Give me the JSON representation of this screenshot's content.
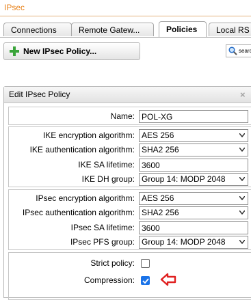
{
  "app": {
    "title": "IPsec"
  },
  "tabs": [
    {
      "label": "Connections"
    },
    {
      "label": "Remote Gatew..."
    },
    {
      "label": "Policies"
    },
    {
      "label": "Local RS"
    }
  ],
  "toolbar": {
    "new_policy_label": "New IPsec Policy...",
    "search_placeholder": "search"
  },
  "dialog": {
    "title": "Edit IPsec Policy",
    "close_glyph": "×",
    "name": {
      "label": "Name:",
      "value": "POL-XG"
    },
    "ike_encryption": {
      "label": "IKE encryption algorithm:",
      "value": "AES 256"
    },
    "ike_authentication": {
      "label": "IKE authentication algorithm:",
      "value": "SHA2 256"
    },
    "ike_sa_lifetime": {
      "label": "IKE SA lifetime:",
      "value": "3600"
    },
    "ike_dh_group": {
      "label": "IKE DH group:",
      "value": "Group 14: MODP 2048"
    },
    "ipsec_encryption": {
      "label": "IPsec encryption algorithm:",
      "value": "AES 256"
    },
    "ipsec_authentication": {
      "label": "IPsec authentication algorithm:",
      "value": "SHA2 256"
    },
    "ipsec_sa_lifetime": {
      "label": "IPsec SA lifetime:",
      "value": "3600"
    },
    "ipsec_pfs_group": {
      "label": "IPsec PFS group:",
      "value": "Group 14: MODP 2048"
    },
    "strict_policy": {
      "label": "Strict policy:",
      "checked": false
    },
    "compression": {
      "label": "Compression:",
      "checked": true
    }
  },
  "colors": {
    "title": "#e8831c",
    "checkbox_accent": "#1a73e8",
    "annotation_arrow": "#e02020",
    "add_icon": "#3aa43a"
  },
  "icons": {
    "add": "plus-icon",
    "search": "magnifier-icon",
    "close": "close-icon",
    "annotation": "red-arrow-icon"
  }
}
